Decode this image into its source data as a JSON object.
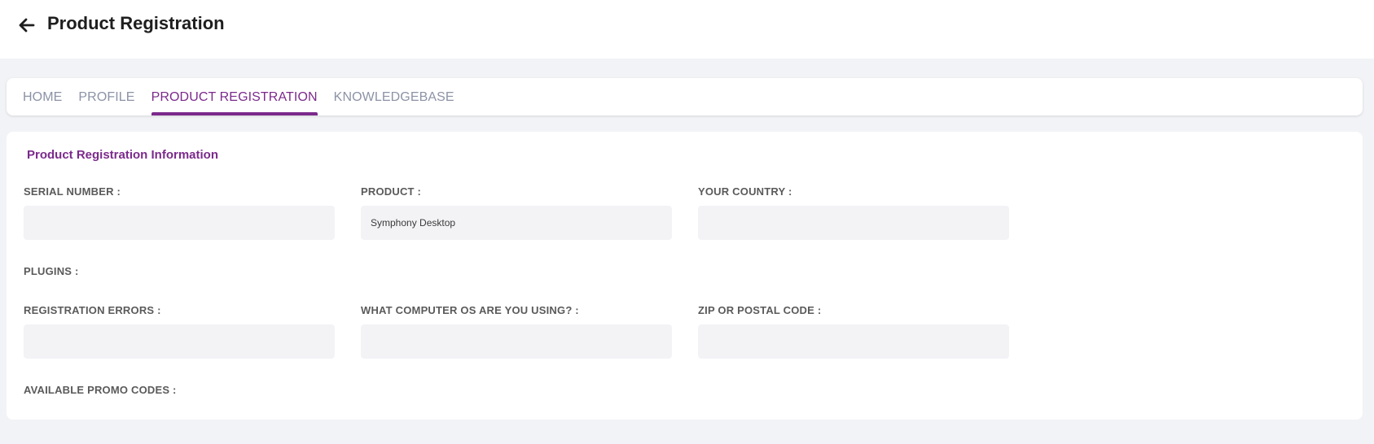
{
  "header": {
    "back_icon": "arrow-left-icon",
    "title": "Product Registration"
  },
  "tabs": [
    {
      "label": "HOME",
      "active": false
    },
    {
      "label": "PROFILE",
      "active": false
    },
    {
      "label": "PRODUCT REGISTRATION",
      "active": true
    },
    {
      "label": "KNOWLEDGEBASE",
      "active": false
    }
  ],
  "form": {
    "section_title": "Product Registration Information",
    "serial_number": {
      "label": "SERIAL NUMBER :",
      "value": ""
    },
    "product": {
      "label": "PRODUCT :",
      "value": "Symphony Desktop"
    },
    "country": {
      "label": "YOUR COUNTRY :",
      "value": ""
    },
    "plugins": {
      "label": "PLUGINS :"
    },
    "registration_errors": {
      "label": "REGISTRATION ERRORS :",
      "value": ""
    },
    "computer_os": {
      "label": "WHAT COMPUTER OS ARE YOU USING? :",
      "value": ""
    },
    "zip_code": {
      "label": "ZIP OR POSTAL CODE :",
      "value": ""
    },
    "promo_codes": {
      "label": "AVAILABLE PROMO CODES :"
    }
  },
  "colors": {
    "accent": "#7b2a8c",
    "tab_inactive": "#8c93a6",
    "page_bg": "#f2f3f6",
    "input_bg": "#f3f2f5"
  }
}
